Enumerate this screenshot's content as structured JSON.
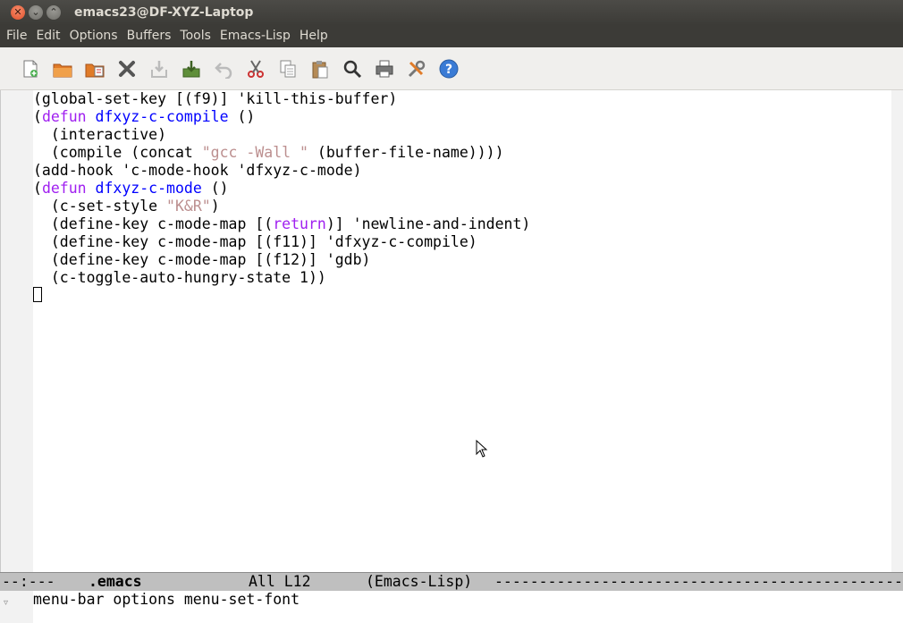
{
  "window": {
    "title": "emacs23@DF-XYZ-Laptop",
    "controls": [
      "close",
      "minimize",
      "maximize"
    ]
  },
  "menubar": {
    "items": [
      "File",
      "Edit",
      "Options",
      "Buffers",
      "Tools",
      "Emacs-Lisp",
      "Help"
    ]
  },
  "toolbar": {
    "buttons": [
      "new-file-icon",
      "open-folder-icon",
      "dired-icon",
      "close-buffer-icon",
      "save-icon",
      "save-as-icon",
      "undo-icon",
      "cut-icon",
      "copy-icon",
      "paste-icon",
      "search-icon",
      "print-icon",
      "preferences-icon",
      "help-icon"
    ]
  },
  "buffer": {
    "lines": [
      [
        {
          "t": "(global-set-key [(f9)] 'kill-this-buffer)"
        }
      ],
      [
        {
          "t": "("
        },
        {
          "t": "defun",
          "c": "kw"
        },
        {
          "t": " "
        },
        {
          "t": "dfxyz-c-compile",
          "c": "fn"
        },
        {
          "t": " ()"
        }
      ],
      [
        {
          "t": "  (interactive)"
        }
      ],
      [
        {
          "t": "  (compile (concat "
        },
        {
          "t": "\"gcc -Wall \"",
          "c": "str"
        },
        {
          "t": " (buffer-file-name))))"
        }
      ],
      [
        {
          "t": "(add-hook 'c-mode-hook 'dfxyz-c-mode)"
        }
      ],
      [
        {
          "t": "("
        },
        {
          "t": "defun",
          "c": "kw"
        },
        {
          "t": " "
        },
        {
          "t": "dfxyz-c-mode",
          "c": "fn"
        },
        {
          "t": " ()"
        }
      ],
      [
        {
          "t": "  (c-set-style "
        },
        {
          "t": "\"K&R\"",
          "c": "str"
        },
        {
          "t": ")"
        }
      ],
      [
        {
          "t": "  (define-key c-mode-map [("
        },
        {
          "t": "return",
          "c": "kw"
        },
        {
          "t": ")] 'newline-and-indent)"
        }
      ],
      [
        {
          "t": "  (define-key c-mode-map [(f11)] 'dfxyz-c-compile)"
        }
      ],
      [
        {
          "t": "  (define-key c-mode-map [(f12)] 'gdb)"
        }
      ],
      [
        {
          "t": "  (c-toggle-auto-hungry-state 1))"
        }
      ]
    ]
  },
  "modeline": {
    "status": "--:---",
    "buffer_name": ".emacs",
    "position": "All L12",
    "mode": "(Emacs-Lisp)",
    "fill": "--------------------------------------------------------------"
  },
  "echo_area": {
    "text": "menu-bar options menu-set-font"
  },
  "colors": {
    "keyword": "#a020f0",
    "function_name": "#0000ff",
    "string": "#bc8f8f",
    "titlebar": "#3c3b37",
    "modeline": "#bfbfbf"
  }
}
